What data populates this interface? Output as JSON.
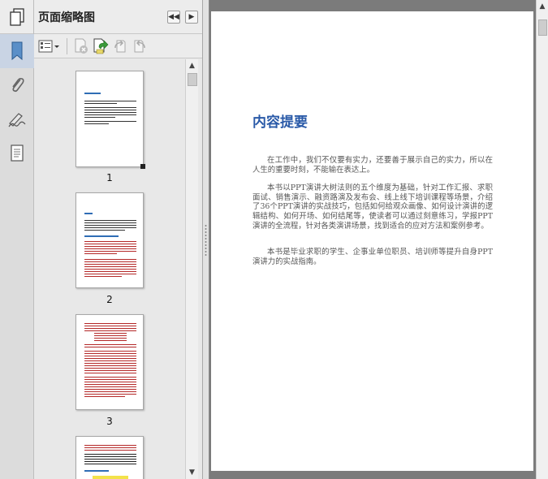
{
  "panel": {
    "title": "页面缩略图",
    "icons": {
      "panel": "page-thumbnails-icon",
      "collapse": "collapse-double-left-icon",
      "next": "expand-right-icon"
    },
    "toolbar": [
      "thumbnail-options-icon",
      "delete-page-icon",
      "insert-page-icon",
      "rotate-left-icon",
      "rotate-right-icon"
    ]
  },
  "rail": {
    "items": [
      "bookmarks-icon",
      "attachments-icon",
      "signatures-icon",
      "layers-icon"
    ]
  },
  "thumbnails": [
    {
      "label": "1"
    },
    {
      "label": "2"
    },
    {
      "label": "3"
    },
    {
      "label": ""
    }
  ],
  "document": {
    "heading": "内容提要",
    "paragraphs": [
      "在工作中，我们不仅要有实力，还要善于展示自己的实力，所以在人生的重要时刻，不能输在表达上。",
      "本书以PPT演讲大树法则的五个维度为基础，针对工作汇报、求职面试、销售演示、融资路演及发布会、线上线下培训课程等场景，介绍了36个PPT演讲的实战技巧，包括如何给观众画像、如何设计演讲的逻辑结构、如何开场、如何结尾等，使读者可以通过刻意练习，学报PPT演讲的全流程，针对各类演讲场景，找到适合的应对方法和案例参考。",
      "本书是毕业求职的学生、企事业单位职员、培训师等提升自身PPT演讲力的实战指南。"
    ]
  },
  "colors": {
    "heading": "#2a5aa8",
    "thumb_heading": "#2f6db5",
    "thumb_text_dark": "#222222",
    "thumb_text_red": "#b42828",
    "thumb_highlight": "#f3e24a",
    "workspace": "#7b7b7b"
  }
}
